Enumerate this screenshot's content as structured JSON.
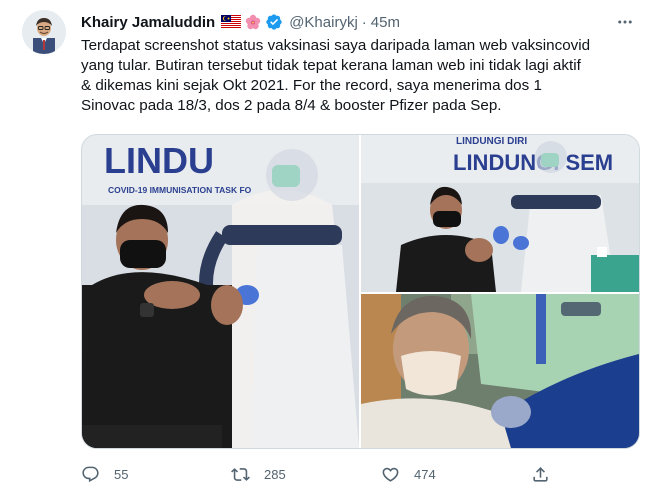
{
  "tweet": {
    "author_name": "Khairy Jamaluddin",
    "handle": "@Khairykj",
    "separator": "·",
    "time": "45m",
    "text_lines": [
      "Terdapat screenshot status vaksinasi saya daripada laman web vaksincovid",
      "yang tular. Butiran tersebut tidak tepat kerana laman web ini tidak lagi aktif",
      "& dikemas kini sejak Okt 2021. For the record, saya menerima dos 1",
      "Sinovac pada 18/3, dos 2 pada 8/4 & booster Pfizer pada Sep."
    ],
    "badges": [
      "malaysia-flag-icon",
      "hibiscus-icon",
      "verified-badge-icon"
    ]
  },
  "media": {
    "photo1": {
      "banner_text": "LINDU",
      "banner_sub": "COVID-19 IMMUNISATION TASK FO"
    },
    "photo2": {
      "banner_text": "LINDUNGI SEM",
      "banner_top": "LINDUNGI DIRI"
    },
    "photo3": {}
  },
  "actions": {
    "reply_count": "55",
    "retweet_count": "285",
    "like_count": "474"
  },
  "colors": {
    "text": "#0f1419",
    "secondary": "#536471",
    "verified": "#1d9bf0",
    "banner_blue": "#2a3f8f"
  }
}
